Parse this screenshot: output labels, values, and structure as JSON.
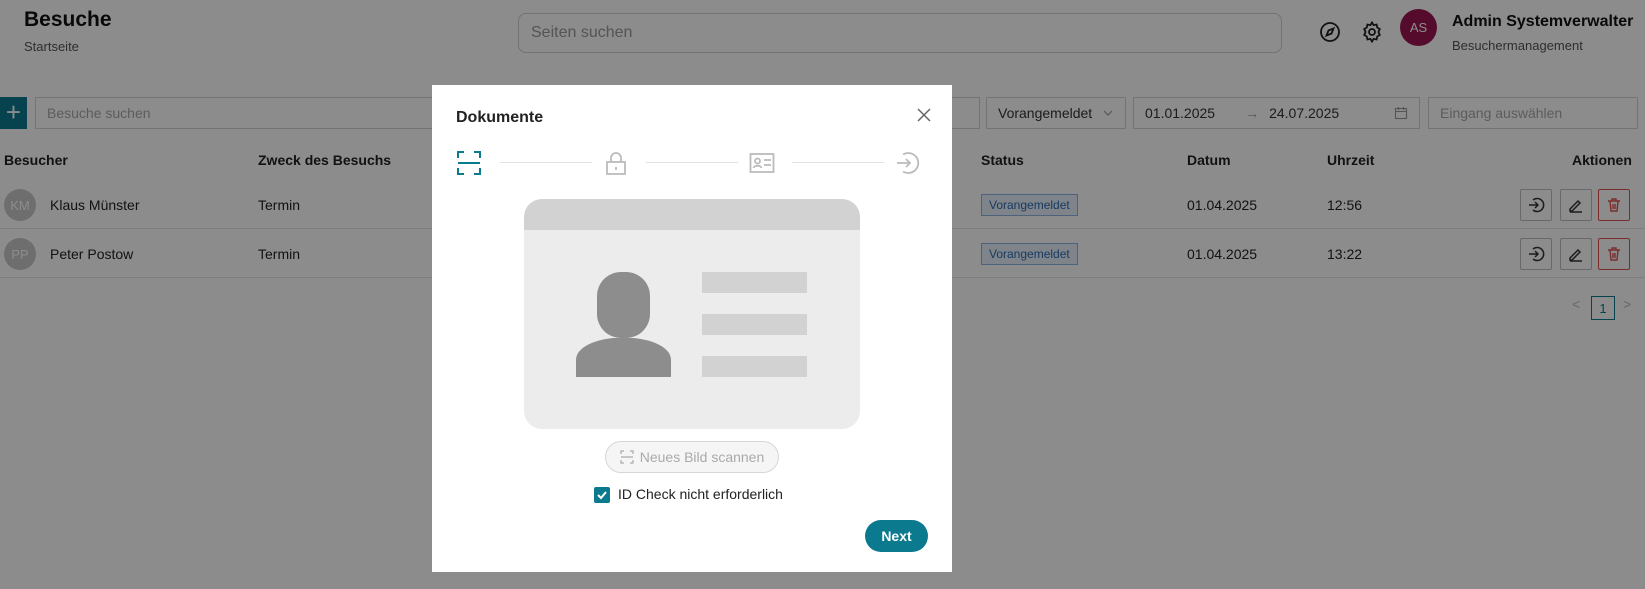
{
  "header": {
    "title": "Besuche",
    "subtitle": "Startseite",
    "search_placeholder": "Seiten suchen",
    "user": {
      "initials": "AS",
      "name": "Admin Systemverwalter",
      "role": "Besuchermanagement"
    }
  },
  "toolbar": {
    "add_label": "+",
    "search_placeholder": "Besuche suchen",
    "status_filter": "Vorangemeldet",
    "date_from": "01.01.2025",
    "date_arrow": "→",
    "date_to": "24.07.2025",
    "entrance_placeholder": "Eingang auswählen"
  },
  "table": {
    "columns": [
      "Besucher",
      "Zweck des Besuchs",
      "Status",
      "Datum",
      "Uhrzeit",
      "Aktionen"
    ],
    "rows": [
      {
        "initials": "KM",
        "name": "Klaus Münster",
        "purpose": "Termin",
        "status": "Vorangemeldet",
        "date": "01.04.2025",
        "time": "12:56"
      },
      {
        "initials": "PP",
        "name": "Peter Postow",
        "purpose": "Termin",
        "status": "Vorangemeldet",
        "date": "01.04.2025",
        "time": "13:22"
      }
    ]
  },
  "pagination": {
    "prev": "<",
    "current": "1",
    "next": ">"
  },
  "modal": {
    "title": "Dokumente",
    "scan_button": "Neues Bild scannen",
    "checkbox_label": "ID Check nicht erforderlich",
    "checkbox_checked": true,
    "next_button": "Next"
  },
  "colors": {
    "accent": "#0b7a8e",
    "avatar": "#9b1751",
    "danger": "#e05252",
    "status_tag": "#2a6bb0"
  }
}
